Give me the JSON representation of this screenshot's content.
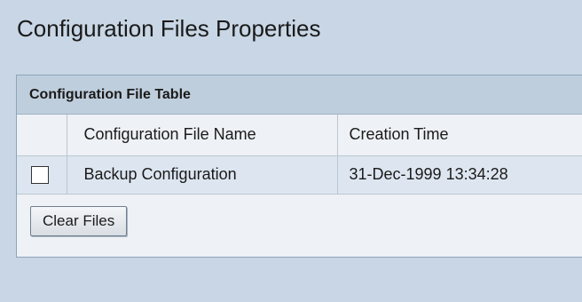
{
  "page": {
    "title": "Configuration Files Properties"
  },
  "table": {
    "header": "Configuration File Table",
    "columns": [
      "",
      "Configuration File Name",
      "Creation Time"
    ],
    "rows": [
      {
        "checked": false,
        "name": "Backup Configuration",
        "created": "31-Dec-1999 13:34:28"
      }
    ]
  },
  "actions": {
    "clear_files_label": "Clear Files"
  },
  "colors": {
    "page_background": "#c8d6e5",
    "panel_header": "#bfcedd",
    "row_background": "#dde6f0"
  }
}
